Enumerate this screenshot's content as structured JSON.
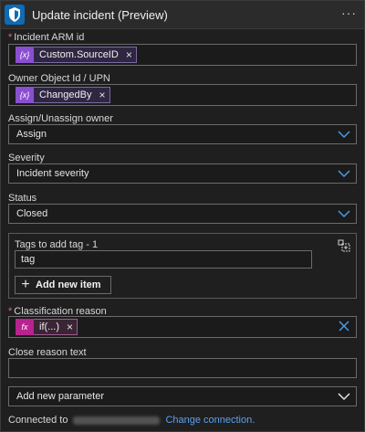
{
  "header": {
    "title": "Update incident (Preview)",
    "menu_glyph": "···",
    "icon": "shield-icon"
  },
  "fields": {
    "incident_arm_id": {
      "label": "Incident ARM id",
      "required_marker": "*",
      "token": {
        "label": "Custom.SourceID",
        "icon_glyph": "{x}",
        "remove": "×"
      }
    },
    "owner": {
      "label": "Owner Object Id / UPN",
      "token": {
        "label": "ChangedBy",
        "icon_glyph": "{x}",
        "remove": "×"
      }
    },
    "assign": {
      "label": "Assign/Unassign owner",
      "value": "Assign"
    },
    "severity": {
      "label": "Severity",
      "value": "Incident severity"
    },
    "status": {
      "label": "Status",
      "value": "Closed"
    },
    "tags": {
      "label": "Tags to add tag - 1",
      "value": "tag",
      "add_label": "Add new item",
      "plus_glyph": "+"
    },
    "classification": {
      "label": "Classification reason",
      "required_marker": "*",
      "token": {
        "label": "if(...)",
        "icon_glyph": "fx",
        "remove": "×"
      }
    },
    "close_reason": {
      "label": "Close reason text",
      "value": ""
    },
    "add_param": {
      "label": "Add new parameter"
    }
  },
  "footer": {
    "connected_label": "Connected to",
    "link": "Change connection."
  },
  "colors": {
    "accent": "#0e6bb5",
    "link": "#5aa0f0",
    "token_var": "#8a4fd1",
    "token_fx": "#b8238f",
    "chevron": "#4a9be8"
  }
}
